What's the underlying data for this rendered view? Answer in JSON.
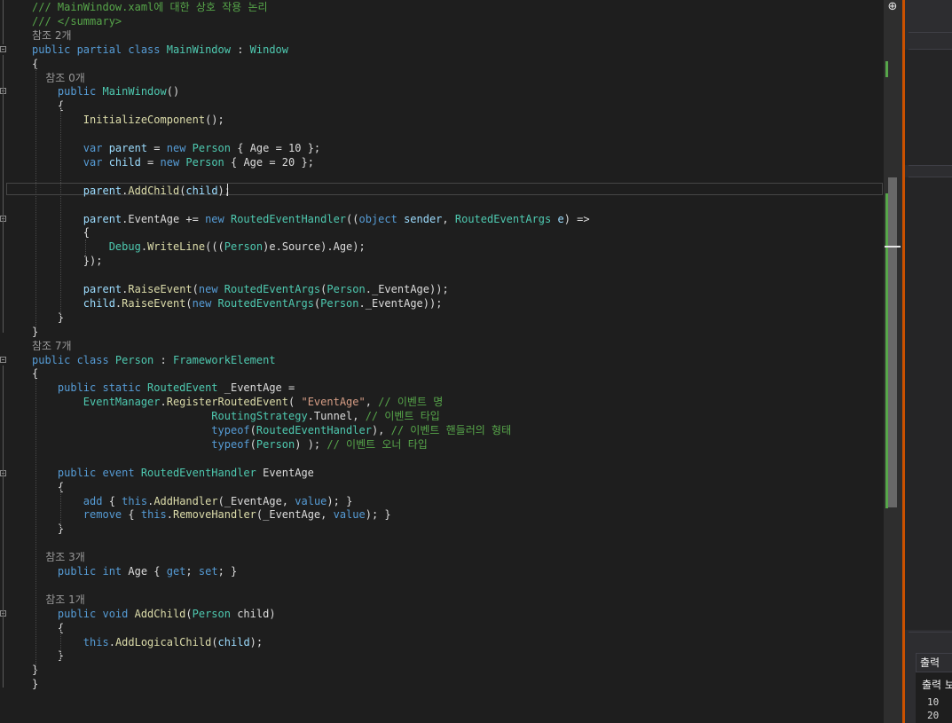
{
  "colors": {
    "keyword": "#569cd6",
    "type": "#4ec9b0",
    "string": "#d69d85",
    "comment": "#57a64a",
    "method": "#dcdcaa",
    "param": "#9cdcfe",
    "text": "#dcdcdc",
    "ref": "#999999",
    "accent": "#ca5100"
  },
  "editor": {
    "lines": [
      [
        {
          "t": "/// MainWindow.xaml에 대한 상호 작용 논리",
          "c": "comment"
        }
      ],
      [
        {
          "t": "/// </summary>",
          "c": "comment"
        }
      ],
      [
        {
          "t": "참조 2개",
          "c": "ref"
        }
      ],
      [
        {
          "t": "public partial class ",
          "c": "keyword"
        },
        {
          "t": "MainWindow",
          "c": "type"
        },
        {
          "t": " : ",
          "c": "text"
        },
        {
          "t": "Window",
          "c": "type"
        }
      ],
      [
        {
          "t": "{",
          "c": "text"
        }
      ],
      [
        {
          "t": "    참조 0개",
          "c": "ref"
        }
      ],
      [
        {
          "t": "    public ",
          "c": "keyword"
        },
        {
          "t": "MainWindow",
          "c": "type"
        },
        {
          "t": "()",
          "c": "text"
        }
      ],
      [
        {
          "t": "    {",
          "c": "text"
        }
      ],
      [
        {
          "t": "        ",
          "c": "text"
        },
        {
          "t": "InitializeComponent",
          "c": "method"
        },
        {
          "t": "();",
          "c": "text"
        }
      ],
      [
        {
          "t": "",
          "c": "text"
        }
      ],
      [
        {
          "t": "        var ",
          "c": "keyword"
        },
        {
          "t": "parent",
          "c": "param"
        },
        {
          "t": " = ",
          "c": "text"
        },
        {
          "t": "new ",
          "c": "keyword"
        },
        {
          "t": "Person",
          "c": "type"
        },
        {
          "t": " { Age = 10 };",
          "c": "text"
        }
      ],
      [
        {
          "t": "        var ",
          "c": "keyword"
        },
        {
          "t": "child",
          "c": "param"
        },
        {
          "t": " = ",
          "c": "text"
        },
        {
          "t": "new ",
          "c": "keyword"
        },
        {
          "t": "Person",
          "c": "type"
        },
        {
          "t": " { Age = 20 };",
          "c": "text"
        }
      ],
      [
        {
          "t": "",
          "c": "text"
        }
      ],
      [
        {
          "t": "        ",
          "c": "text"
        },
        {
          "t": "parent",
          "c": "param"
        },
        {
          "t": ".",
          "c": "text"
        },
        {
          "t": "AddChild",
          "c": "method"
        },
        {
          "t": "(",
          "c": "text"
        },
        {
          "t": "child",
          "c": "param"
        },
        {
          "t": ");",
          "c": "text"
        }
      ],
      [
        {
          "t": "",
          "c": "text"
        }
      ],
      [
        {
          "t": "        ",
          "c": "text"
        },
        {
          "t": "parent",
          "c": "param"
        },
        {
          "t": ".EventAge += ",
          "c": "text"
        },
        {
          "t": "new ",
          "c": "keyword"
        },
        {
          "t": "RoutedEventHandler",
          "c": "type"
        },
        {
          "t": "((",
          "c": "text"
        },
        {
          "t": "object ",
          "c": "keyword"
        },
        {
          "t": "sender",
          "c": "param"
        },
        {
          "t": ", ",
          "c": "text"
        },
        {
          "t": "RoutedEventArgs ",
          "c": "type"
        },
        {
          "t": "e",
          "c": "param"
        },
        {
          "t": ") =>",
          "c": "text"
        }
      ],
      [
        {
          "t": "        {",
          "c": "text"
        }
      ],
      [
        {
          "t": "            ",
          "c": "text"
        },
        {
          "t": "Debug",
          "c": "type"
        },
        {
          "t": ".",
          "c": "text"
        },
        {
          "t": "WriteLine",
          "c": "method"
        },
        {
          "t": "(((",
          "c": "text"
        },
        {
          "t": "Person",
          "c": "type"
        },
        {
          "t": ")e.Source).Age);",
          "c": "text"
        }
      ],
      [
        {
          "t": "        });",
          "c": "text"
        }
      ],
      [
        {
          "t": "",
          "c": "text"
        }
      ],
      [
        {
          "t": "        ",
          "c": "text"
        },
        {
          "t": "parent",
          "c": "param"
        },
        {
          "t": ".",
          "c": "text"
        },
        {
          "t": "RaiseEvent",
          "c": "method"
        },
        {
          "t": "(",
          "c": "text"
        },
        {
          "t": "new ",
          "c": "keyword"
        },
        {
          "t": "RoutedEventArgs",
          "c": "type"
        },
        {
          "t": "(",
          "c": "text"
        },
        {
          "t": "Person",
          "c": "type"
        },
        {
          "t": "._EventAge));",
          "c": "text"
        }
      ],
      [
        {
          "t": "        ",
          "c": "text"
        },
        {
          "t": "child",
          "c": "param"
        },
        {
          "t": ".",
          "c": "text"
        },
        {
          "t": "RaiseEvent",
          "c": "method"
        },
        {
          "t": "(",
          "c": "text"
        },
        {
          "t": "new ",
          "c": "keyword"
        },
        {
          "t": "RoutedEventArgs",
          "c": "type"
        },
        {
          "t": "(",
          "c": "text"
        },
        {
          "t": "Person",
          "c": "type"
        },
        {
          "t": "._EventAge));",
          "c": "text"
        }
      ],
      [
        {
          "t": "    }",
          "c": "text"
        }
      ],
      [
        {
          "t": "}",
          "c": "text"
        }
      ],
      [
        {
          "t": "참조 7개",
          "c": "ref"
        }
      ],
      [
        {
          "t": "public class ",
          "c": "keyword"
        },
        {
          "t": "Person",
          "c": "type"
        },
        {
          "t": " : ",
          "c": "text"
        },
        {
          "t": "FrameworkElement",
          "c": "type"
        }
      ],
      [
        {
          "t": "{",
          "c": "text"
        }
      ],
      [
        {
          "t": "    public static ",
          "c": "keyword"
        },
        {
          "t": "RoutedEvent",
          "c": "type"
        },
        {
          "t": " _EventAge =",
          "c": "text"
        }
      ],
      [
        {
          "t": "        ",
          "c": "text"
        },
        {
          "t": "EventManager",
          "c": "type"
        },
        {
          "t": ".",
          "c": "text"
        },
        {
          "t": "RegisterRoutedEvent",
          "c": "method"
        },
        {
          "t": "( ",
          "c": "text"
        },
        {
          "t": "\"EventAge\"",
          "c": "string"
        },
        {
          "t": ", ",
          "c": "text"
        },
        {
          "t": "// 이벤트 명",
          "c": "comment"
        }
      ],
      [
        {
          "t": "                            ",
          "c": "text"
        },
        {
          "t": "RoutingStrategy",
          "c": "type"
        },
        {
          "t": ".Tunnel, ",
          "c": "text"
        },
        {
          "t": "// 이벤트 타입",
          "c": "comment"
        }
      ],
      [
        {
          "t": "                            ",
          "c": "text"
        },
        {
          "t": "typeof",
          "c": "keyword"
        },
        {
          "t": "(",
          "c": "text"
        },
        {
          "t": "RoutedEventHandler",
          "c": "type"
        },
        {
          "t": "), ",
          "c": "text"
        },
        {
          "t": "// 이벤트 핸들러의 형태",
          "c": "comment"
        }
      ],
      [
        {
          "t": "                            ",
          "c": "text"
        },
        {
          "t": "typeof",
          "c": "keyword"
        },
        {
          "t": "(",
          "c": "text"
        },
        {
          "t": "Person",
          "c": "type"
        },
        {
          "t": ") ); ",
          "c": "text"
        },
        {
          "t": "// 이벤트 오너 타입",
          "c": "comment"
        }
      ],
      [
        {
          "t": "",
          "c": "text"
        }
      ],
      [
        {
          "t": "    public event ",
          "c": "keyword"
        },
        {
          "t": "RoutedEventHandler",
          "c": "type"
        },
        {
          "t": " EventAge",
          "c": "text"
        }
      ],
      [
        {
          "t": "    {",
          "c": "text"
        }
      ],
      [
        {
          "t": "        add",
          "c": "keyword"
        },
        {
          "t": " { ",
          "c": "text"
        },
        {
          "t": "this",
          "c": "keyword"
        },
        {
          "t": ".",
          "c": "text"
        },
        {
          "t": "AddHandler",
          "c": "method"
        },
        {
          "t": "(_EventAge, ",
          "c": "text"
        },
        {
          "t": "value",
          "c": "keyword"
        },
        {
          "t": "); }",
          "c": "text"
        }
      ],
      [
        {
          "t": "        remove",
          "c": "keyword"
        },
        {
          "t": " { ",
          "c": "text"
        },
        {
          "t": "this",
          "c": "keyword"
        },
        {
          "t": ".",
          "c": "text"
        },
        {
          "t": "RemoveHandler",
          "c": "method"
        },
        {
          "t": "(_EventAge, ",
          "c": "text"
        },
        {
          "t": "value",
          "c": "keyword"
        },
        {
          "t": "); }",
          "c": "text"
        }
      ],
      [
        {
          "t": "    }",
          "c": "text"
        }
      ],
      [
        {
          "t": "",
          "c": "text"
        }
      ],
      [
        {
          "t": "    참조 3개",
          "c": "ref"
        }
      ],
      [
        {
          "t": "    public int ",
          "c": "keyword"
        },
        {
          "t": "Age { ",
          "c": "text"
        },
        {
          "t": "get",
          "c": "keyword"
        },
        {
          "t": "; ",
          "c": "text"
        },
        {
          "t": "set",
          "c": "keyword"
        },
        {
          "t": "; }",
          "c": "text"
        }
      ],
      [
        {
          "t": "",
          "c": "text"
        }
      ],
      [
        {
          "t": "    참조 1개",
          "c": "ref"
        }
      ],
      [
        {
          "t": "    public void ",
          "c": "keyword"
        },
        {
          "t": "AddChild",
          "c": "method"
        },
        {
          "t": "(",
          "c": "text"
        },
        {
          "t": "Person",
          "c": "type"
        },
        {
          "t": " child)",
          "c": "text"
        }
      ],
      [
        {
          "t": "    {",
          "c": "text"
        }
      ],
      [
        {
          "t": "        this",
          "c": "keyword"
        },
        {
          "t": ".",
          "c": "text"
        },
        {
          "t": "AddLogicalChild",
          "c": "method"
        },
        {
          "t": "(",
          "c": "text"
        },
        {
          "t": "child",
          "c": "param"
        },
        {
          "t": ");",
          "c": "text"
        }
      ],
      [
        {
          "t": "    }",
          "c": "text"
        }
      ],
      [
        {
          "t": "}",
          "c": "text"
        }
      ],
      [
        {
          "t": "}",
          "c": "text"
        }
      ]
    ]
  },
  "scrollbar": {
    "split_icon": "split-icon"
  },
  "output_panel": {
    "tab_label": "출력",
    "title": "출력 보",
    "values": [
      "10",
      "20"
    ]
  }
}
